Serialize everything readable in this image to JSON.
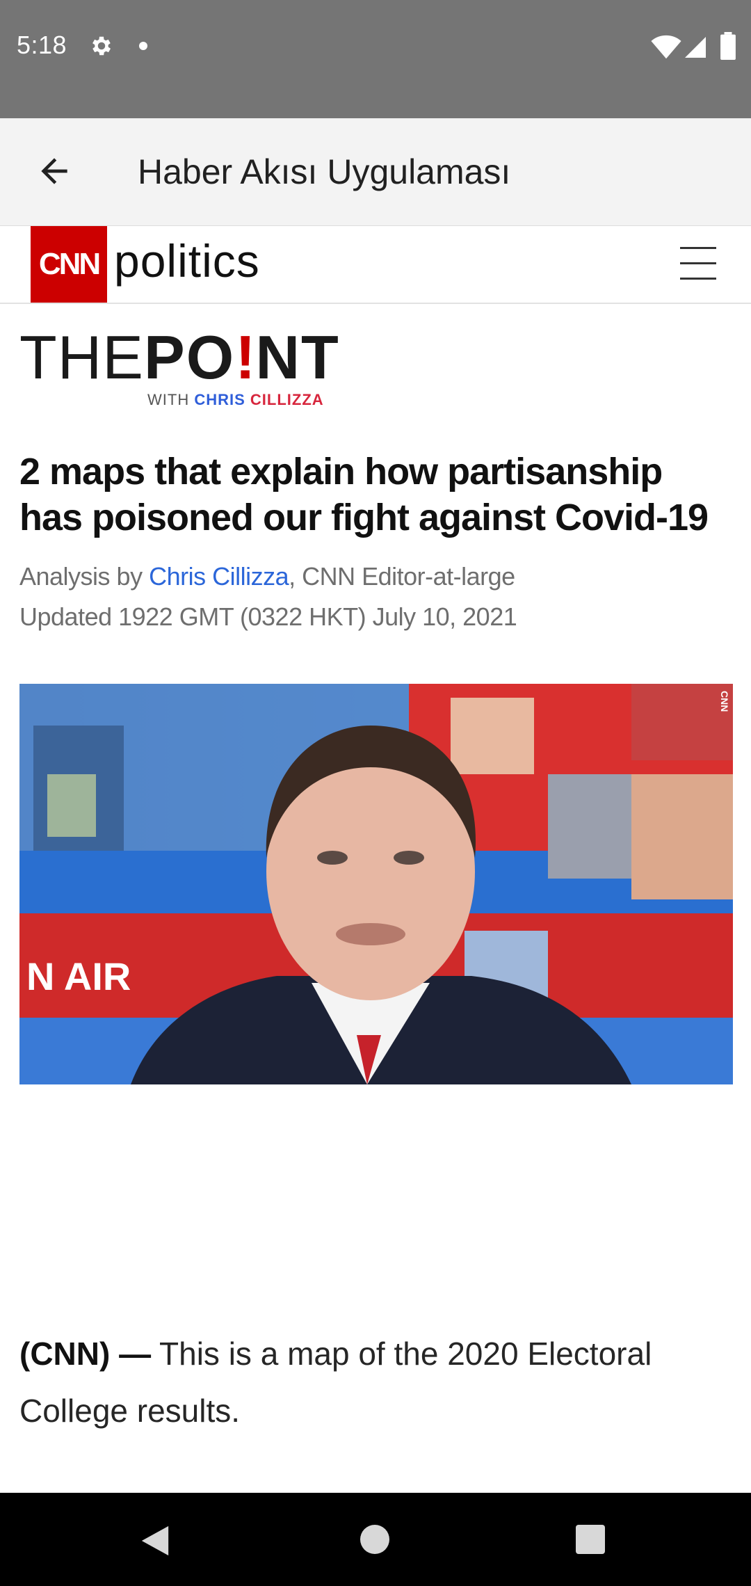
{
  "status_bar": {
    "time": "5:18",
    "icons": [
      "gear-icon",
      "dot-icon",
      "wifi-icon",
      "signal-icon",
      "battery-icon"
    ]
  },
  "app_bar": {
    "title": "Haber Akısı Uygulaması",
    "back_icon": "arrow-left-icon"
  },
  "cnn_header": {
    "logo_text": "CNN",
    "section": "politics",
    "menu_icon": "hamburger-icon",
    "brand_color": "#cc0000"
  },
  "point_logo": {
    "the": "THE",
    "po": "PO",
    "bang": "!",
    "nt": "NT",
    "with": "WITH",
    "chris": "CHRIS",
    "cillizza": "CILLIZZA"
  },
  "article": {
    "headline": "2 maps that explain how partisanship has poisoned our fight against Covid-19",
    "byline_prefix": "Analysis by ",
    "author": "Chris Cillizza",
    "byline_suffix": ", CNN Editor-at-large",
    "updated": "Updated 1922 GMT (0322 HKT) July 10, 2021",
    "image_watermark": "CNN",
    "image_overlay_text": "N AIR",
    "lead": "(CNN) —",
    "body": " This is a map of the 2020 Electoral College results."
  },
  "nav_bar": {
    "icons": [
      "back-triangle-icon",
      "home-circle-icon",
      "recents-square-icon"
    ]
  }
}
